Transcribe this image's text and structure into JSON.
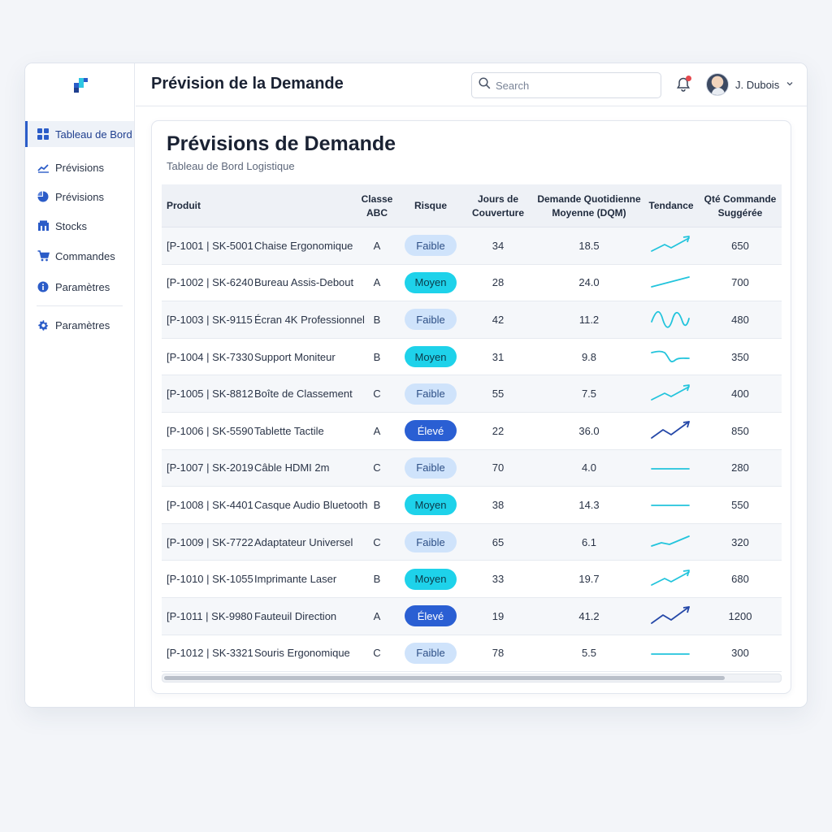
{
  "header": {
    "title": "Prévision de la Demande"
  },
  "search": {
    "placeholder": "Search"
  },
  "user": {
    "name": "J. Dubois"
  },
  "sidebar": {
    "items": [
      {
        "label": "Tableau de Bord",
        "icon": "dashboard-icon",
        "active": true
      },
      {
        "label": "Prévisions",
        "icon": "line-chart-icon"
      },
      {
        "label": "Prévisions",
        "icon": "pie-chart-icon"
      },
      {
        "label": "Stocks",
        "icon": "warehouse-icon"
      },
      {
        "label": "Commandes",
        "icon": "cart-icon"
      },
      {
        "label": "Paramètres",
        "icon": "info-icon"
      },
      {
        "label": "Paramètres",
        "icon": "gear-icon"
      }
    ]
  },
  "card": {
    "title": "Prévisions de Demande",
    "subtitle": "Tableau de Bord Logistique"
  },
  "table": {
    "headers": {
      "product": "Produit",
      "abc": "Classe ABC",
      "risk": "Risque",
      "coverage": "Jours de Couverture",
      "dqm": "Demande Quotidienne Moyenne (DQM)",
      "trend": "Tendance",
      "qty": "Qté Commande Suggérée"
    },
    "rows": [
      {
        "code": "[P-1001 | SK-5001",
        "name": "Chaise Ergonomique",
        "abc": "A",
        "risk": "Faible",
        "coverage": "34",
        "dqm": "18.5",
        "trend": "up-light",
        "qty": "650"
      },
      {
        "code": "[P-1002 | SK-6240",
        "name": "Bureau Assis-Debout",
        "abc": "A",
        "risk": "Moyen",
        "coverage": "28",
        "dqm": "24.0",
        "trend": "rising-line",
        "qty": "700"
      },
      {
        "code": "[P-1003 | SK-9115",
        "name": "Écran 4K Professionnel",
        "abc": "B",
        "risk": "Faible",
        "coverage": "42",
        "dqm": "11.2",
        "trend": "wave",
        "qty": "480"
      },
      {
        "code": "[P-1004 | SK-7330",
        "name": "Support Moniteur",
        "abc": "B",
        "risk": "Moyen",
        "coverage": "31",
        "dqm": "9.8",
        "trend": "dip",
        "qty": "350"
      },
      {
        "code": "[P-1005 | SK-8812",
        "name": "Boîte de Classement",
        "abc": "C",
        "risk": "Faible",
        "coverage": "55",
        "dqm": "7.5",
        "trend": "up-light",
        "qty": "400"
      },
      {
        "code": "[P-1006 | SK-5590",
        "name": "Tablette Tactile",
        "abc": "A",
        "risk": "Élevé",
        "coverage": "22",
        "dqm": "36.0",
        "trend": "up-strong",
        "qty": "850"
      },
      {
        "code": "[P-1007 | SK-2019",
        "name": "Câble HDMI 2m",
        "abc": "C",
        "risk": "Faible",
        "coverage": "70",
        "dqm": "4.0",
        "trend": "flat",
        "qty": "280"
      },
      {
        "code": "[P-1008 | SK-4401",
        "name": "Casque Audio Bluetooth",
        "abc": "B",
        "risk": "Moyen",
        "coverage": "38",
        "dqm": "14.3",
        "trend": "flat",
        "qty": "550"
      },
      {
        "code": "[P-1009 | SK-7722",
        "name": "Adaptateur Universel",
        "abc": "C",
        "risk": "Faible",
        "coverage": "65",
        "dqm": "6.1",
        "trend": "mild-up",
        "qty": "320"
      },
      {
        "code": "[P-1010 | SK-1055",
        "name": "Imprimante Laser",
        "abc": "B",
        "risk": "Moyen",
        "coverage": "33",
        "dqm": "19.7",
        "trend": "up-light",
        "qty": "680"
      },
      {
        "code": "[P-1011 | SK-9980",
        "name": "Fauteuil Direction",
        "abc": "A",
        "risk": "Élevé",
        "coverage": "19",
        "dqm": "41.2",
        "trend": "up-strong",
        "qty": "1200"
      },
      {
        "code": "[P-1012 | SK-3321",
        "name": "Souris Ergonomique",
        "abc": "C",
        "risk": "Faible",
        "coverage": "78",
        "dqm": "5.5",
        "trend": "flat",
        "qty": "300"
      }
    ]
  },
  "colors": {
    "risk_low_bg": "#cfe3fb",
    "risk_low_text": "#2d4f86",
    "risk_mid_bg": "#1ed2ea",
    "risk_mid_text": "#0b3a4a",
    "risk_high_bg": "#2a5fd3",
    "risk_high_text": "#ffffff",
    "trend_light": "#22c4dc",
    "trend_dark": "#2548a8"
  }
}
